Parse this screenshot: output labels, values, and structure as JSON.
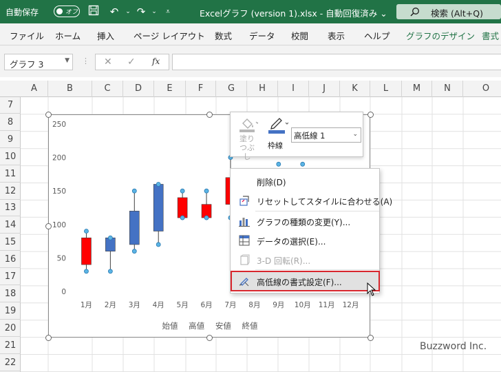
{
  "titlebar": {
    "autosave_label": "自動保存",
    "autosave_state": "オフ",
    "document_title": "Excelグラフ (version 1).xlsx  -  自動回復済み  ⌄",
    "search_label": "検索 (Alt+Q)"
  },
  "ribbon": {
    "tabs": [
      "ファイル",
      "ホーム",
      "挿入",
      "ページ レイアウト",
      "数式",
      "データ",
      "校閲",
      "表示",
      "ヘルプ",
      "グラフのデザイン",
      "書式"
    ]
  },
  "formula_bar": {
    "name_box": "グラフ 3",
    "fx": "fx"
  },
  "grid": {
    "columns": [
      "A",
      "B",
      "C",
      "D",
      "E",
      "F",
      "G",
      "H",
      "I",
      "J",
      "K",
      "L",
      "M",
      "N",
      "O"
    ],
    "rows": [
      "7",
      "8",
      "9",
      "10",
      "11",
      "12",
      "13",
      "14",
      "15",
      "16",
      "17",
      "18",
      "19",
      "20",
      "21",
      "22"
    ]
  },
  "chart_data": {
    "type": "bar",
    "categories": [
      "1月",
      "2月",
      "3月",
      "4月",
      "5月",
      "6月",
      "7月",
      "8月",
      "9月",
      "10月",
      "11月",
      "12月"
    ],
    "series": [
      {
        "name": "始値",
        "values": [
          80,
          60,
          70,
          90,
          140,
          130,
          170,
          null,
          null,
          null,
          null,
          null
        ]
      },
      {
        "name": "高値",
        "values": [
          90,
          80,
          150,
          160,
          150,
          150,
          200,
          null,
          190,
          190,
          null,
          null
        ]
      },
      {
        "name": "安値",
        "values": [
          30,
          30,
          60,
          70,
          110,
          110,
          110,
          null,
          null,
          null,
          null,
          null
        ]
      },
      {
        "name": "終値",
        "values": [
          40,
          80,
          120,
          160,
          110,
          110,
          130,
          null,
          null,
          null,
          null,
          null
        ]
      }
    ],
    "yticks": [
      "0",
      "50",
      "100",
      "150",
      "200",
      "250"
    ],
    "ylim": [
      0,
      250
    ],
    "legend": [
      "始値",
      "高値",
      "安値",
      "終値"
    ],
    "colors": {
      "up": "#4472C4",
      "down": "#FF0000",
      "marker": "#5BB4E5"
    }
  },
  "mini_toolbar": {
    "fill_label": "塗りつぶし",
    "outline_label": "枠線",
    "element_select": "高低線 1"
  },
  "context_menu": {
    "items": [
      {
        "label": "削除(D)",
        "enabled": true
      },
      {
        "label": "リセットしてスタイルに合わせる(A)",
        "enabled": true
      },
      {
        "label": "グラフの種類の変更(Y)...",
        "enabled": true
      },
      {
        "label": "データの選択(E)...",
        "enabled": true
      },
      {
        "label": "3-D 回転(R)...",
        "enabled": false
      },
      {
        "label": "高低線の書式設定(F)...",
        "enabled": true
      }
    ]
  },
  "watermark": "Buzzword Inc."
}
